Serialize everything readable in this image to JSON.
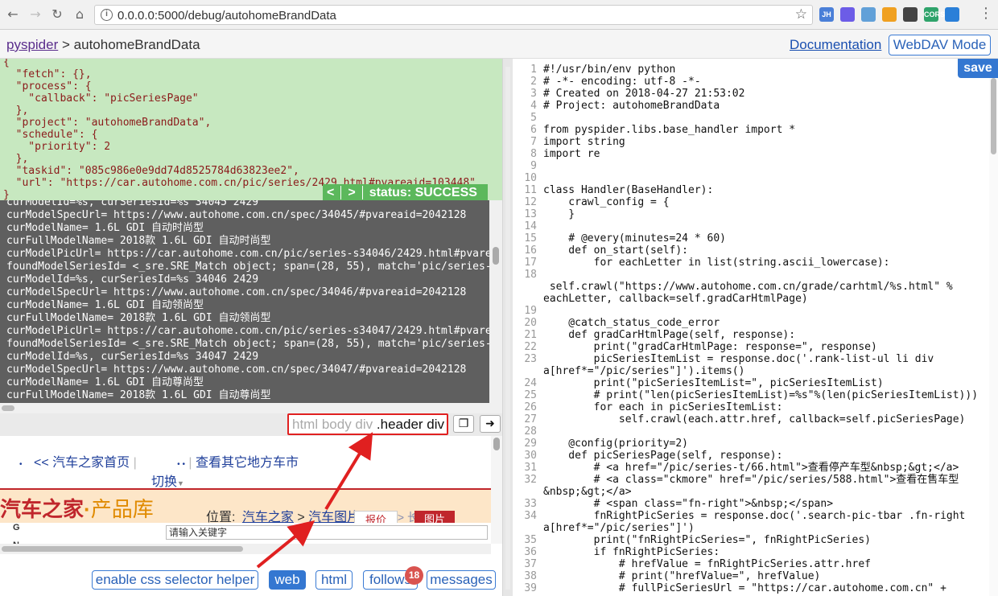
{
  "browser": {
    "url": "0.0.0.0:5000/debug/autohomeBrandData",
    "extensions": [
      {
        "name": "jh-extension-icon",
        "label": "JH",
        "color": "#4a7fd8"
      },
      {
        "name": "wappalyzer-icon",
        "label": "",
        "color": "#6c5ce7"
      },
      {
        "name": "react-devtools-icon",
        "label": "",
        "color": "#61a0d8"
      },
      {
        "name": "grid-extension-icon",
        "label": "",
        "color": "#f0a020"
      },
      {
        "name": "qrcode-icon",
        "label": "",
        "color": "#444444"
      },
      {
        "name": "cors-icon",
        "label": "CORS",
        "color": "#2fa36b"
      },
      {
        "name": "link-extension-icon",
        "label": "",
        "color": "#2a7fd8"
      }
    ]
  },
  "header": {
    "home_link": "pyspider",
    "separator": ">",
    "project": "autohomeBrandData",
    "documentation": "Documentation",
    "webdav": "WebDAV Mode"
  },
  "task": {
    "json_lines": [
      "{",
      "  \"fetch\": {},",
      "  \"process\": {",
      "    \"callback\": \"picSeriesPage\"",
      "  },",
      "  \"project\": \"autohomeBrandData\",",
      "  \"schedule\": {",
      "    \"priority\": 2",
      "  },",
      "  \"taskid\": \"085c986e0e9dd74d8525784d63823ee2\",",
      "  \"url\": \"https://car.autohome.com.cn/pic/series/2429.html#pvareaid=103448\"",
      "}"
    ],
    "prev": "<",
    "next": ">",
    "status": "status: SUCCESS"
  },
  "log_lines": [
    "curModelId=%s, curSeriesId=%s 34045 2429",
    "curModelSpecUrl= https://www.autohome.com.cn/spec/34045/#pvareaid=2042128",
    "curModelName= 1.6L GDI 自动时尚型",
    "curFullModelName= 2018款 1.6L GDI 自动时尚型",
    "curModelPicUrl= https://car.autohome.com.cn/pic/series-s34046/2429.html#pvare",
    "foundModelSeriesId= <_sre.SRE_Match object; span=(28, 55), match='pic/series-",
    "curModelId=%s, curSeriesId=%s 34046 2429",
    "curModelSpecUrl= https://www.autohome.com.cn/spec/34046/#pvareaid=2042128",
    "curModelName= 1.6L GDI 自动领尚型",
    "curFullModelName= 2018款 1.6L GDI 自动领尚型",
    "curModelPicUrl= https://car.autohome.com.cn/pic/series-s34047/2429.html#pvare",
    "foundModelSeriesId= <_sre.SRE_Match object; span=(28, 55), match='pic/series-",
    "curModelId=%s, curSeriesId=%s 34047 2429",
    "curModelSpecUrl= https://www.autohome.com.cn/spec/34047/#pvareaid=2042128",
    "curModelName= 1.6L GDI 自动尊尚型",
    "curFullModelName= 2018款 1.6L GDI 自动尊尚型"
  ],
  "css_selector": {
    "path_dim": "html body div",
    "path_current": ".header div",
    "copy_icon": "copy-icon",
    "go_icon": "arrow-right-icon"
  },
  "web_preview": {
    "home_link": "<< 汽车之家首页",
    "dots": "• •",
    "other_cities": "查看其它地方车市",
    "switch": "切换",
    "logo_text": "汽车之家",
    "logo_dot": "·",
    "logo_product": "产品库",
    "location_label": "位置:",
    "bc_home": "汽车之家",
    "bc_gt": ">",
    "bc_pics": "汽车图片",
    "bc_tail": "长安 > 长安汽车",
    "price_btn": "报价",
    "pic_btn": "图片",
    "search_placeholder": "请输入关键字",
    "side_g": "G",
    "side_n": "N"
  },
  "bottom": {
    "css_helper": "enable css selector helper",
    "web": "web",
    "html": "html",
    "follows": "follows",
    "follows_count": "18",
    "messages": "messages"
  },
  "editor": {
    "save": "save",
    "lines": [
      {
        "n": "1",
        "t": "#!/usr/bin/env python",
        "c": "cm"
      },
      {
        "n": "2",
        "t": "# -*- encoding: utf-8 -*-",
        "c": "cm"
      },
      {
        "n": "3",
        "t": "# Created on 2018-04-27 21:53:02",
        "c": "cm"
      },
      {
        "n": "4",
        "t": "# Project: autohomeBrandData",
        "c": "cm"
      },
      {
        "n": "5",
        "t": "",
        "c": ""
      },
      {
        "n": "6",
        "t": "from pyspider.libs.base_handler import *",
        "c": ""
      },
      {
        "n": "7",
        "t": "import string",
        "c": ""
      },
      {
        "n": "8",
        "t": "import re",
        "c": ""
      },
      {
        "n": "9",
        "t": "",
        "c": ""
      },
      {
        "n": "10",
        "t": "",
        "c": ""
      },
      {
        "n": "11",
        "t": "class Handler(BaseHandler):",
        "c": ""
      },
      {
        "n": "12",
        "t": "    crawl_config = {",
        "c": ""
      },
      {
        "n": "13",
        "t": "    }",
        "c": ""
      },
      {
        "n": "14",
        "t": "",
        "c": ""
      },
      {
        "n": "15",
        "t": "    # @every(minutes=24 * 60)",
        "c": "cm"
      },
      {
        "n": "16",
        "t": "    def on_start(self):",
        "c": ""
      },
      {
        "n": "17",
        "t": "        for eachLetter in list(string.ascii_lowercase):",
        "c": ""
      },
      {
        "n": "18",
        "t": "",
        "c": ""
      },
      {
        "n": "",
        "t": " self.crawl(\"https://www.autohome.com.cn/grade/carhtml/%s.html\" %",
        "c": ""
      },
      {
        "n": "",
        "t": "eachLetter, callback=self.gradCarHtmlPage)",
        "c": ""
      },
      {
        "n": "19",
        "t": "",
        "c": ""
      },
      {
        "n": "20",
        "t": "    @catch_status_code_error",
        "c": ""
      },
      {
        "n": "21",
        "t": "    def gradCarHtmlPage(self, response):",
        "c": ""
      },
      {
        "n": "22",
        "t": "        print(\"gradCarHtmlPage: response=\", response)",
        "c": ""
      },
      {
        "n": "23",
        "t": "        picSeriesItemList = response.doc('.rank-list-ul li div",
        "c": ""
      },
      {
        "n": "",
        "t": "a[href*=\"/pic/series\"]').items()",
        "c": ""
      },
      {
        "n": "24",
        "t": "        print(\"picSeriesItemList=\", picSeriesItemList)",
        "c": ""
      },
      {
        "n": "25",
        "t": "        # print(\"len(picSeriesItemList)=%s\"%(len(picSeriesItemList)))",
        "c": "cm"
      },
      {
        "n": "26",
        "t": "        for each in picSeriesItemList:",
        "c": ""
      },
      {
        "n": "27",
        "t": "            self.crawl(each.attr.href, callback=self.picSeriesPage)",
        "c": ""
      },
      {
        "n": "28",
        "t": "",
        "c": ""
      },
      {
        "n": "29",
        "t": "    @config(priority=2)",
        "c": ""
      },
      {
        "n": "30",
        "t": "    def picSeriesPage(self, response):",
        "c": ""
      },
      {
        "n": "31",
        "t": "        # <a href=\"/pic/series-t/66.html\">查看停产车型&nbsp;&gt;</a>",
        "c": "cm"
      },
      {
        "n": "32",
        "t": "        # <a class=\"ckmore\" href=\"/pic/series/588.html\">查看在售车型",
        "c": "cm"
      },
      {
        "n": "",
        "t": "&nbsp;&gt;</a>",
        "c": "cm"
      },
      {
        "n": "33",
        "t": "        # <span class=\"fn-right\">&nbsp;</span>",
        "c": "cm"
      },
      {
        "n": "34",
        "t": "        fnRightPicSeries = response.doc('.search-pic-tbar .fn-right",
        "c": ""
      },
      {
        "n": "",
        "t": "a[href*=\"/pic/series\"]')",
        "c": ""
      },
      {
        "n": "35",
        "t": "        print(\"fnRightPicSeries=\", fnRightPicSeries)",
        "c": ""
      },
      {
        "n": "36",
        "t": "        if fnRightPicSeries:",
        "c": ""
      },
      {
        "n": "37",
        "t": "            # hrefValue = fnRightPicSeries.attr.href",
        "c": "cm"
      },
      {
        "n": "38",
        "t": "            # print(\"hrefValue=\", hrefValue)",
        "c": "cm"
      },
      {
        "n": "39",
        "t": "            # fullPicSeriesUrl = \"https://car.autohome.com.cn\" +",
        "c": "cm"
      }
    ]
  }
}
